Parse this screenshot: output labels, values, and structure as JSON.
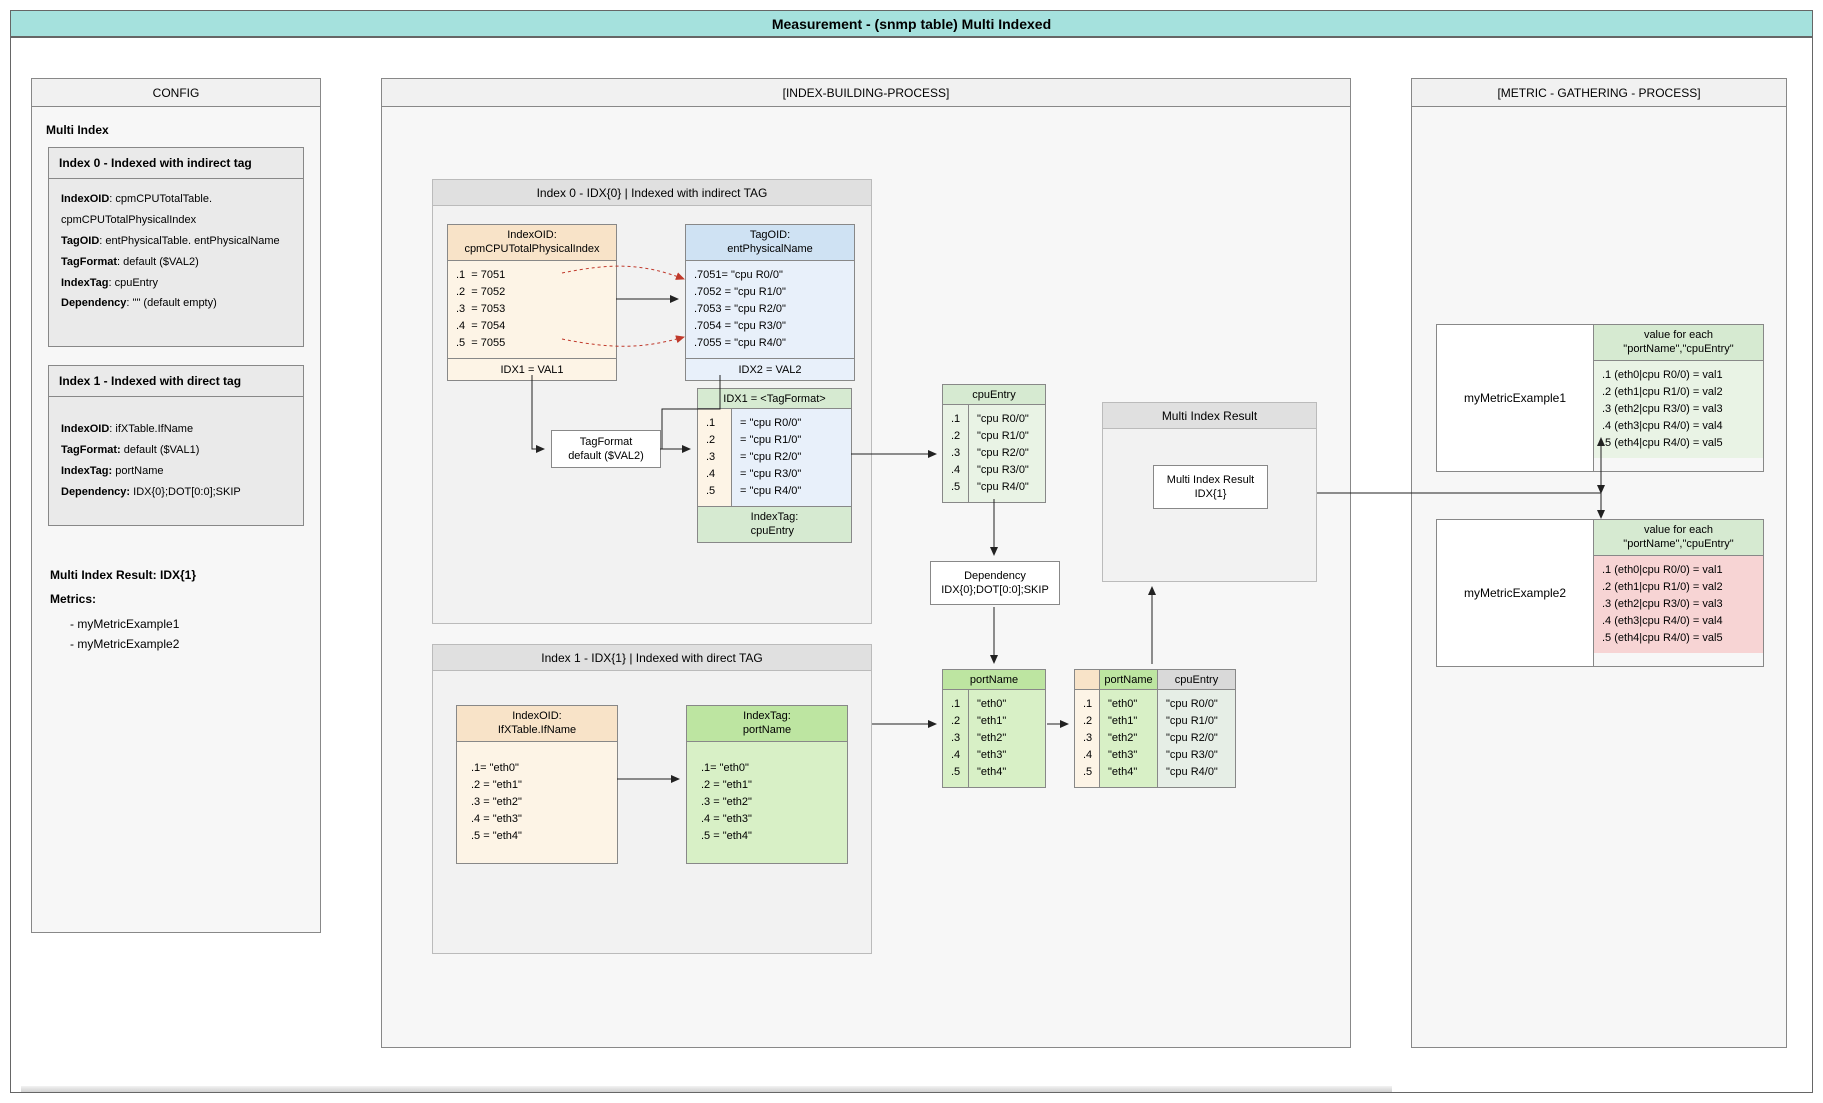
{
  "title": "Measurement - (snmp table) Multi Indexed",
  "config": {
    "header": "CONFIG",
    "sub": "Multi Index",
    "index0": {
      "title": "Index 0 - Indexed with indirect tag",
      "indexOID_label": "IndexOID",
      "indexOID_val": "cpmCPUTotalTable. cpmCPUTotalPhysicalIndex",
      "tagOID_label": "TagOID",
      "tagOID_val": "entPhysicalTable. entPhysicalName",
      "tagFormat_label": "TagFormat",
      "tagFormat_val": "default ($VAL2)",
      "indexTag_label": "IndexTag",
      "indexTag_val": "cpuEntry",
      "dependency_label": "Dependency",
      "dependency_val": "\"\" (default empty)"
    },
    "index1": {
      "title": "Index 1 - Indexed with direct tag",
      "indexOID_label": "IndexOID",
      "indexOID_val": "ifXTable.IfName",
      "tagFormat_label": "TagFormat:",
      "tagFormat_val": "default ($VAL1)",
      "indexTag_label": "IndexTag:",
      "indexTag_val": "portName",
      "dependency_label": "Dependency:",
      "dependency_val": "IDX{0};DOT[0:0];SKIP"
    },
    "resultLine": "Multi Index Result: IDX{1}",
    "metricsLabel": "Metrics:",
    "metrics": [
      "myMetricExample1",
      "myMetricExample2"
    ]
  },
  "ibp": {
    "header": "[INDEX-BUILDING-PROCESS]",
    "idx0": {
      "head": "Index 0 - IDX{0} | Indexed with indirect TAG",
      "indexOID_head": "IndexOID:\ncpmCPUTotalPhysicalIndex",
      "indexOID_rows": ".1  = 7051\n.2  = 7052\n.3  = 7053\n.4  = 7054\n.5  = 7055",
      "indexOID_foot": "IDX1 = VAL1",
      "tagOID_head": "TagOID:\nentPhysicalName",
      "tagOID_rows": ".7051= \"cpu R0/0\"\n.7052 = \"cpu R1/0\"\n.7053 = \"cpu R2/0\"\n.7054 = \"cpu R3/0\"\n.7055 = \"cpu R4/0\"",
      "tagOID_foot": "IDX2 = VAL2",
      "tagFormat_box": "TagFormat\ndefault ($VAL2)",
      "rtHead": "IDX1 = <TagFormat>",
      "rtIdxCol": ".1\n.2\n.3\n.4\n.5",
      "rtValCol": "= \"cpu R0/0\"\n= \"cpu R1/0\"\n= \"cpu R2/0\"\n= \"cpu R3/0\"\n= \"cpu R4/0\"",
      "rtFoot": "IndexTag:\ncpuEntry",
      "cpuEntry_head": "cpuEntry",
      "cpuEntry_idx": ".1\n.2\n.3\n.4\n.5",
      "cpuEntry_val": "\"cpu R0/0\"\n\"cpu R1/0\"\n\"cpu R2/0\"\n\"cpu R3/0\"\n\"cpu R4/0\""
    },
    "dep_box": "Dependency\nIDX{0};DOT[0:0];SKIP",
    "idx1": {
      "head": "Index 1 - IDX{1} |  Indexed with direct TAG",
      "indexOID_head": "IndexOID:\nIfXTable.IfName",
      "indexOID_rows": ".1= \"eth0\"\n.2 = \"eth1\"\n.3 = \"eth2\"\n.4 = \"eth3\"\n.5 = \"eth4\"",
      "indexTag_head": "IndexTag:\nportName",
      "indexTag_rows": ".1= \"eth0\"\n.2 = \"eth1\"\n.3 = \"eth2\"\n.4 = \"eth3\"\n.5 = \"eth4\"",
      "portName_head": "portName",
      "portName_idx": ".1\n.2\n.3\n.4\n.5",
      "portName_val": "\"eth0\"\n\"eth1\"\n\"eth2\"\n\"eth3\"\n\"eth4\"",
      "merged_portName_head": "portName",
      "merged_cpuEntry_head": "cpuEntry",
      "merged_idx": ".1\n.2\n.3\n.4\n.5",
      "merged_port": "\"eth0\"\n\"eth1\"\n\"eth2\"\n\"eth3\"\n\"eth4\"",
      "merged_cpu": "\"cpu R0/0\"\n\"cpu R1/0\"\n\"cpu R2/0\"\n\"cpu R3/0\"\n\"cpu R4/0\""
    },
    "mir_group_head": "Multi Index Result",
    "mir_box": "Multi Index Result\nIDX{1}"
  },
  "mgp": {
    "header": "[METRIC - GATHERING - PROCESS]",
    "m1_name": "myMetricExample1",
    "m1_head": "value for each\n\"portName\",\"cpuEntry\"",
    "m1_rows": ".1 (eth0|cpu R0/0) = val1\n.2 (eth1|cpu R1/0) = val2\n.3 (eth2|cpu R3/0) = val3\n.4 (eth3|cpu R4/0) = val4\n.5 (eth4|cpu R4/0) = val5",
    "m2_name": "myMetricExample2",
    "m2_head": "value for each\n\"portName\",\"cpuEntry\"",
    "m2_rows": ".1 (eth0|cpu R0/0) = val1\n.2 (eth1|cpu R1/0) = val2\n.3 (eth2|cpu R3/0) = val3\n.4 (eth3|cpu R4/0) = val4\n.5 (eth4|cpu R4/0) = val5"
  }
}
